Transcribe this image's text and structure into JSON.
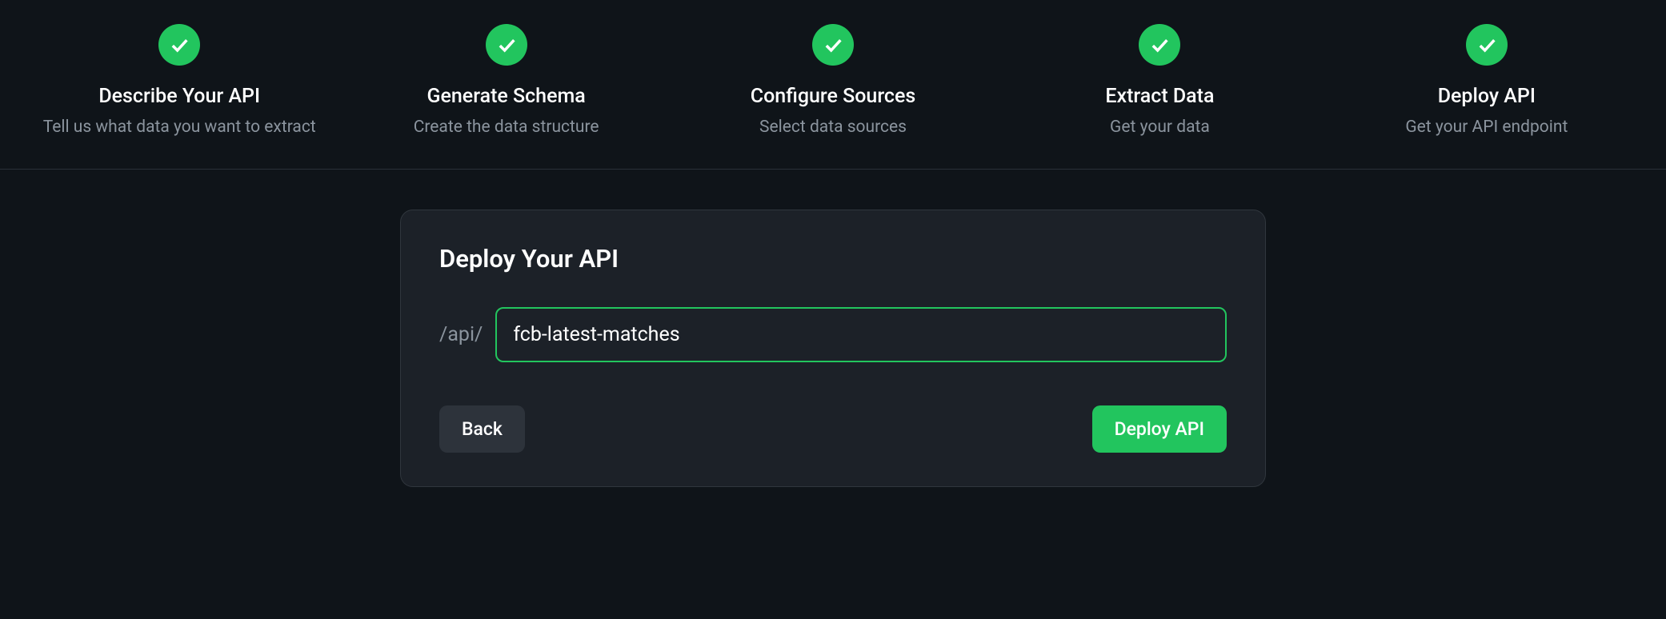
{
  "stepper": {
    "steps": [
      {
        "title": "Describe Your API",
        "subtitle": "Tell us what data you want to extract"
      },
      {
        "title": "Generate Schema",
        "subtitle": "Create the data structure"
      },
      {
        "title": "Configure Sources",
        "subtitle": "Select data sources"
      },
      {
        "title": "Extract Data",
        "subtitle": "Get your data"
      },
      {
        "title": "Deploy API",
        "subtitle": "Get your API endpoint"
      }
    ]
  },
  "card": {
    "title": "Deploy Your API",
    "input_prefix": "/api/",
    "input_value": "fcb-latest-matches",
    "back_button": "Back",
    "deploy_button": "Deploy API"
  }
}
